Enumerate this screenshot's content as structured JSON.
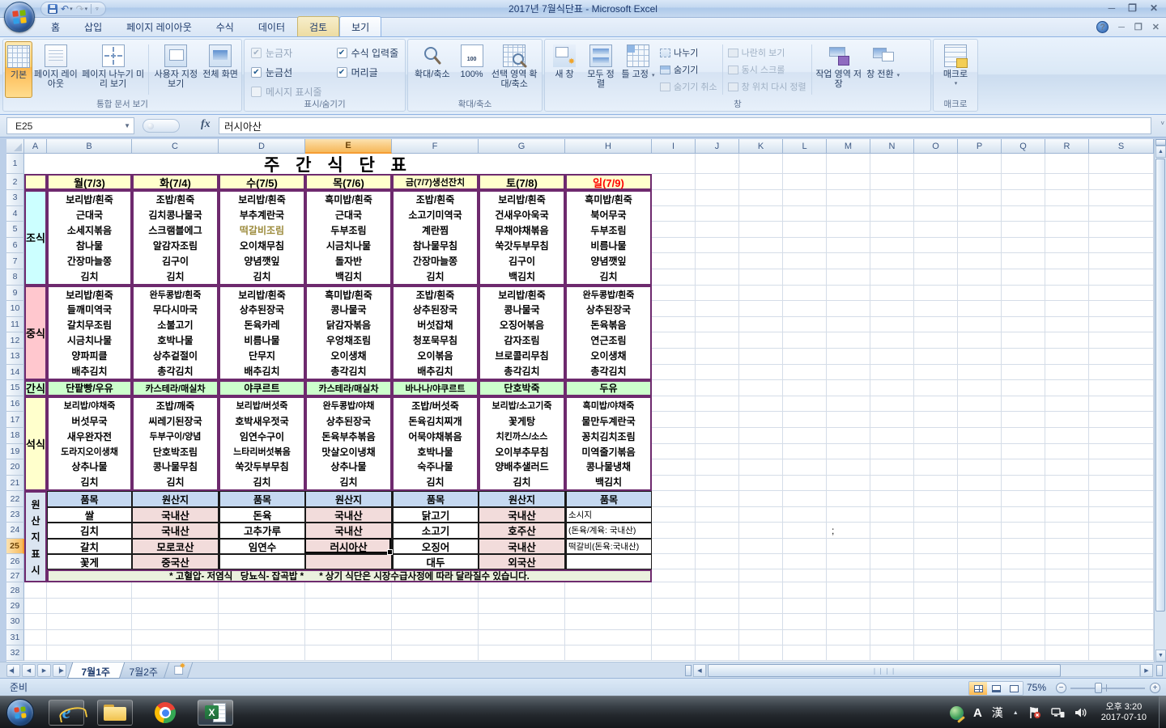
{
  "window": {
    "title": "2017년 7월식단표 - Microsoft Excel"
  },
  "ribbon": {
    "tabs": [
      "홈",
      "삽입",
      "페이지 레이아웃",
      "수식",
      "데이터",
      "검토",
      "보기"
    ],
    "active_tab": "보기",
    "view_group": {
      "label": "통합 문서 보기",
      "buttons": [
        "기본",
        "페이지 레이아웃",
        "페이지 나누기 미리 보기",
        "사용자 지정 보기",
        "전체 화면"
      ]
    },
    "show_group": {
      "label": "표시/숨기기",
      "checkboxes": [
        {
          "label": "눈금자",
          "checked": true,
          "enabled": false
        },
        {
          "label": "눈금선",
          "checked": true,
          "enabled": true
        },
        {
          "label": "메시지 표시줄",
          "checked": false,
          "enabled": false
        },
        {
          "label": "수식 입력줄",
          "checked": true,
          "enabled": true
        },
        {
          "label": "머리글",
          "checked": true,
          "enabled": true
        }
      ]
    },
    "zoom_group": {
      "label": "확대/축소",
      "buttons": [
        "확대/축소",
        "100%",
        "선택 영역 확대/축소"
      ]
    },
    "window_group": {
      "label": "창",
      "big_buttons": [
        "새 창",
        "모두 정렬",
        "틀 고정"
      ],
      "small_buttons": [
        {
          "label": "나누기",
          "enabled": true
        },
        {
          "label": "숨기기",
          "enabled": true
        },
        {
          "label": "숨기기 취소",
          "enabled": false
        },
        {
          "label": "나란히 보기",
          "enabled": false
        },
        {
          "label": "동시 스크롤",
          "enabled": false
        },
        {
          "label": "창 위치 다시 정렬",
          "enabled": false
        }
      ],
      "extra_buttons": [
        "작업 영역 저장",
        "창 전환"
      ]
    },
    "macro_group": {
      "label": "매크로",
      "button": "매크로"
    }
  },
  "formula_bar": {
    "name_box": "E25",
    "fx_label": "fx",
    "value": "러시아산"
  },
  "grid": {
    "columns": [
      "A",
      "B",
      "C",
      "D",
      "E",
      "F",
      "G",
      "H",
      "I",
      "J",
      "K",
      "L",
      "M",
      "N",
      "O",
      "P",
      "Q",
      "R",
      "S"
    ],
    "selected_column": "E",
    "row_count": 32,
    "selected_row": 25,
    "stray_cell": {
      "ref": "M24",
      "text": ";"
    }
  },
  "menu": {
    "title": "주 간 식 단 표",
    "day_headers": [
      "월(7/3)",
      "화(7/4)",
      "수(7/5)",
      "목(7/6)",
      "금(7/7)생선잔치",
      "토(7/8)",
      "일(7/9)"
    ],
    "muted_item": {
      "section": 0,
      "day": 2,
      "item": 2,
      "color": "#9C8B3C"
    },
    "sections": [
      {
        "label": "조식",
        "days": [
          [
            "보리밥/흰죽",
            "근대국",
            "소세지볶음",
            "참나물",
            "간장마늘쫑",
            "김치"
          ],
          [
            "조밥/흰죽",
            "김치콩나물국",
            "스크램블에그",
            "알감자조림",
            "김구이",
            "김치"
          ],
          [
            "보리밥/흰죽",
            "부추계란국",
            "떡갈비조림",
            "오이채무침",
            "양념깻잎",
            "김치"
          ],
          [
            "흑미밥/흰죽",
            "근대국",
            "두부조림",
            "시금치나물",
            "돌자반",
            "백김치"
          ],
          [
            "조밥/흰죽",
            "소고기미역국",
            "계란찜",
            "참나물무침",
            "간장마늘쫑",
            "김치"
          ],
          [
            "보리밥/흰죽",
            "건새우아욱국",
            "무채야채볶음",
            "쑥갓두부무침",
            "김구이",
            "백김치"
          ],
          [
            "흑미밥/흰죽",
            "북어무국",
            "두부조림",
            "비름나물",
            "양념깻잎",
            "김치"
          ]
        ]
      },
      {
        "label": "중식",
        "days": [
          [
            "보리밥/흰죽",
            "들깨미역국",
            "갈치무조림",
            "시금치나물",
            "양파피클",
            "배추김치"
          ],
          [
            "완두콩밥/흰죽",
            "무다시마국",
            "소불고기",
            "호박나물",
            "상추겉절이",
            "총각김치"
          ],
          [
            "보리밥/흰죽",
            "상추된장국",
            "돈육카레",
            "비름나물",
            "단무지",
            "배추김치"
          ],
          [
            "흑미밥/흰죽",
            "콩나물국",
            "닭감자볶음",
            "우엉채조림",
            "오이생채",
            "총각김치"
          ],
          [
            "조밥/흰죽",
            "상추된장국",
            "버섯잡채",
            "청포묵무침",
            "오이볶음",
            "배추김치"
          ],
          [
            "보리밥/흰죽",
            "콩나물국",
            "오징어볶음",
            "감자조림",
            "브로콜리무침",
            "총각김치"
          ],
          [
            "완두콩밥/흰죽",
            "상추된장국",
            "돈육볶음",
            "연근조림",
            "오이생채",
            "총각김치"
          ]
        ]
      },
      {
        "label": "간식",
        "days": [
          [
            "단팥빵/우유"
          ],
          [
            "카스테라/매실차"
          ],
          [
            "야쿠르트"
          ],
          [
            "카스테라/매실차"
          ],
          [
            "바나나/야쿠르트"
          ],
          [
            "단호박죽"
          ],
          [
            "두유"
          ]
        ]
      },
      {
        "label": "석식",
        "days": [
          [
            "보리밥/야채죽",
            "버섯무국",
            "새우완자전",
            "도라지오이생채",
            "상추나물",
            "김치"
          ],
          [
            "조밥/깨죽",
            "씨레기된장국",
            "두부구이/양념",
            "단호박조림",
            "콩나물무침",
            "김치"
          ],
          [
            "보리밥/버섯죽",
            "호박새우젓국",
            "임연수구이",
            "느타리버섯볶음",
            "쑥갓두부무침",
            "김치"
          ],
          [
            "완두콩밥/야채",
            "상추된장국",
            "돈육부추볶음",
            "맛살오이냉채",
            "상추나물",
            "김치"
          ],
          [
            "조밥/버섯죽",
            "돈육김치찌개",
            "어묵야채볶음",
            "호박나물",
            "숙주나물",
            "김치"
          ],
          [
            "보리밥/소고기죽",
            "꽃게탕",
            "치킨까스/소스",
            "오이부추무침",
            "양배추샐러드",
            "김치"
          ],
          [
            "흑미밥/야채죽",
            "물만두계란국",
            "꽁치김치조림",
            "미역줄기볶음",
            "콩나물냉채",
            "백김치"
          ]
        ]
      }
    ],
    "origin": {
      "label": "원산지표시",
      "header_row": [
        "품목",
        "원산지",
        "품목",
        "원산지",
        "품목",
        "원산지",
        "품목"
      ],
      "rows": [
        [
          "쌀",
          "국내산",
          "돈육",
          "국내산",
          "닭고기",
          "국내산",
          "소시지"
        ],
        [
          "김치",
          "국내산",
          "고추가루",
          "국내산",
          "소고기",
          "호주산",
          "(돈육/계육: 국내산)"
        ],
        [
          "갈치",
          "모로코산",
          "임연수",
          "러시아산",
          "오징어",
          "국내산",
          "떡갈비(돈육:국내산)"
        ],
        [
          "꽃게",
          "중국산",
          "",
          "",
          "대두",
          "외국산",
          ""
        ]
      ],
      "note": "* 고혈압- 저염식   당뇨식- 잡곡밥 *      * 상기 식단은 시장수급사정에 따라 달라질수 있습니다."
    }
  },
  "sheet_tabs": {
    "tabs": [
      "7월1주",
      "7월2주"
    ],
    "active_tab": "7월1주"
  },
  "status_bar": {
    "mode": "준비",
    "zoom": "75%"
  },
  "taskbar": {
    "ime_letter": "A",
    "ime_han": "漢",
    "time": "오후 3:20",
    "date": "2017-07-10"
  },
  "colors": {
    "selection_accent": "#F59D33",
    "table_border": "#6E2A6E",
    "sunday_red": "#FF0000",
    "flag_colors": [
      "#E4452B",
      "#7DB700",
      "#2F9FE8",
      "#FFC20E"
    ]
  }
}
